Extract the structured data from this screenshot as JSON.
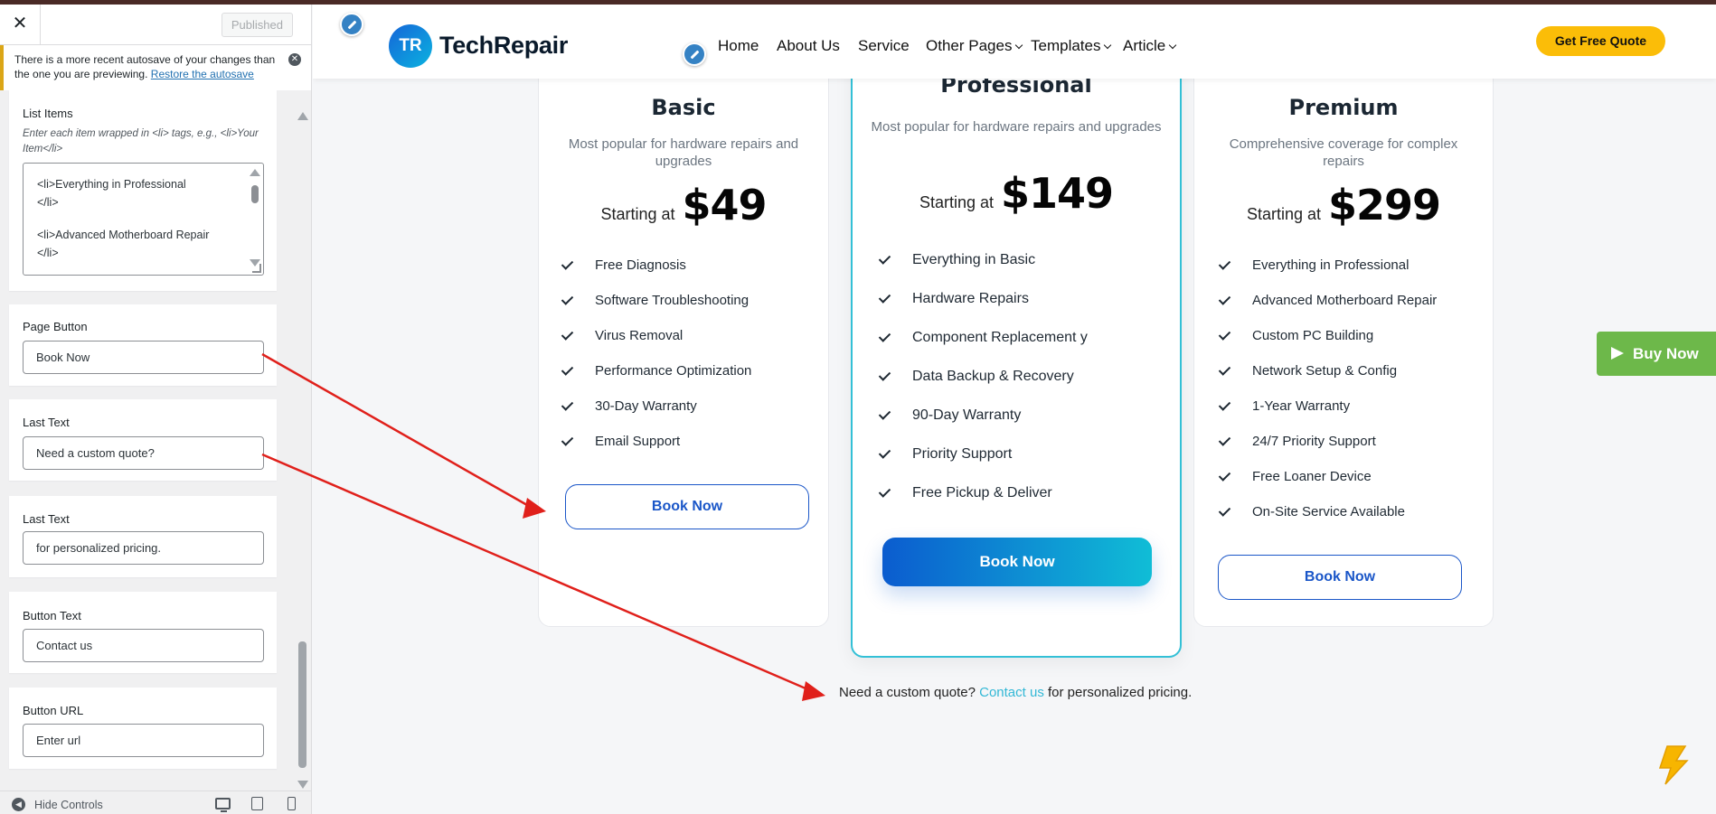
{
  "sidebar": {
    "close_icon": "close-icon",
    "published_label": "Published",
    "notice": {
      "text": "There is a more recent autosave of your changes than the one you are previewing.",
      "link": "Restore the autosave"
    },
    "list_items": {
      "label": "List Items",
      "description": "Enter each item wrapped in <li> tags, e.g., <li>Your Item</li>",
      "lines": [
        "<li>Everything in Professional",
        "</li>",
        "",
        "<li>Advanced Motherboard Repair",
        "</li>"
      ]
    },
    "page_button": {
      "label": "Page Button",
      "value": "Book Now"
    },
    "last_text_1": {
      "label": "Last Text",
      "value": "Need a custom quote?"
    },
    "last_text_2": {
      "label": "Last Text",
      "value": "for personalized pricing."
    },
    "button_text": {
      "label": "Button Text",
      "value": "Contact us"
    },
    "button_url": {
      "label": "Button URL",
      "placeholder": "Enter url"
    },
    "footer": {
      "hide_controls": "Hide Controls"
    }
  },
  "preview": {
    "logo": {
      "mark": "TR",
      "name": "TechRepair"
    },
    "nav": [
      "Home",
      "About Us",
      "Service",
      "Other Pages",
      "Templates",
      "Article"
    ],
    "quote_button": "Get Free Quote",
    "plans": [
      {
        "name": "Basic",
        "description": "Most popular for hardware repairs and upgrades",
        "starting": "Starting at",
        "price": "$49",
        "features": [
          "Free Diagnosis",
          "Software Troubleshooting",
          "Virus Removal",
          "Performance Optimization",
          "30-Day Warranty",
          "Email Support"
        ],
        "button": "Book Now"
      },
      {
        "name": "Professional",
        "description": "Most popular for hardware repairs and upgrades",
        "starting": "Starting at",
        "price": "$149",
        "features": [
          "Everything in Basic",
          "Hardware Repairs",
          "Component Replacement y",
          "Data Backup & Recovery",
          "90-Day Warranty",
          "Priority Support",
          "Free Pickup & Deliver"
        ],
        "button": "Book Now"
      },
      {
        "name": "Premium",
        "description": "Comprehensive coverage for complex repairs",
        "starting": "Starting at",
        "price": "$299",
        "features": [
          "Everything in Professional",
          "Advanced Motherboard Repair",
          "Custom PC Building",
          "Network Setup & Config",
          "1-Year Warranty",
          "24/7 Priority Support",
          "Free Loaner Device",
          "On-Site Service Available"
        ],
        "button": "Book Now"
      }
    ],
    "custom_quote": {
      "before": "Need a custom quote?",
      "link": "Contact us",
      "after": "for personalized pricing."
    },
    "buy_now": "Buy Now"
  },
  "colors": {
    "accent_yellow": "#fbbd08",
    "brand_blue": "#1a56c8",
    "featured_border": "#33c0d6",
    "buy_green": "#6db84a",
    "annotation_arrow": "#e0201b"
  }
}
